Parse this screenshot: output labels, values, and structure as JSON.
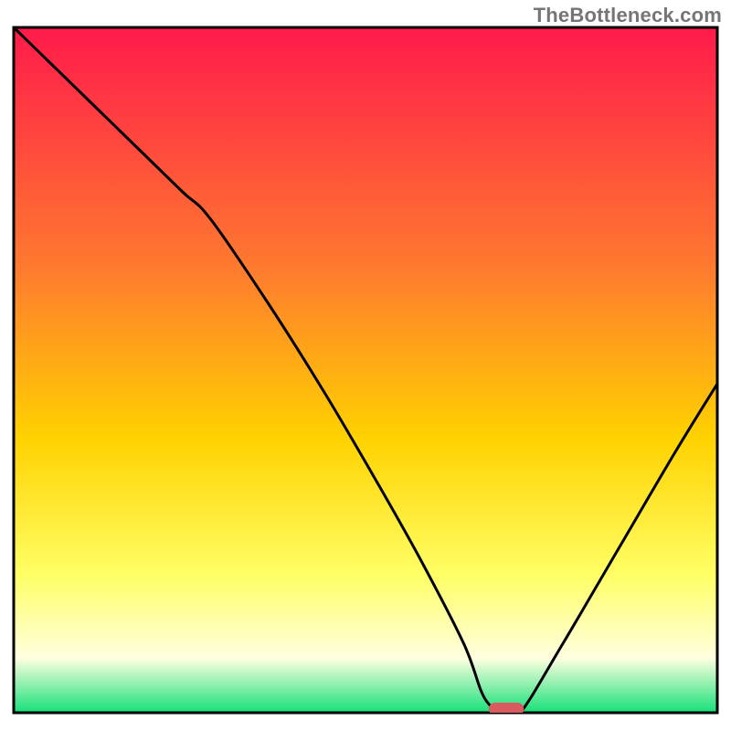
{
  "watermark": "TheBottleneck.com",
  "colors": {
    "gradient_top": "#ff1a4b",
    "gradient_mid1": "#ff7a2f",
    "gradient_mid2": "#ffd200",
    "gradient_mid3": "#ffff66",
    "gradient_mid4": "#ffffe0",
    "gradient_bottom": "#17e079",
    "curve": "#000000",
    "marker_fill": "#d95a5f",
    "frame": "#000000"
  },
  "chart_data": {
    "type": "line",
    "title": "",
    "xlabel": "",
    "ylabel": "",
    "xlim": [
      0,
      100
    ],
    "ylim": [
      0,
      100
    ],
    "notes": "Y is a mismatch/bottleneck percentage (0 at bottom, 100 at top). X is an unlabeled configuration axis. Curve drops from ~100 at the left edge to ~0 near x≈68–72 (the optimal point, marked by a red pill on the x-axis), then rises again toward the right edge.",
    "series": [
      {
        "name": "curve",
        "x": [
          0,
          6,
          12,
          18,
          24,
          28,
          36,
          44,
          52,
          58,
          64,
          67,
          70,
          72,
          78,
          86,
          94,
          100
        ],
        "values": [
          100,
          94,
          88,
          82,
          76,
          72,
          60,
          47,
          33,
          22,
          10,
          2,
          0,
          0,
          10,
          24,
          38,
          48
        ]
      }
    ],
    "flat_segment": {
      "x_start": 67,
      "x_end": 72,
      "y": 0
    },
    "marker": {
      "x_center": 70,
      "x_halfwidth": 2.5,
      "y": 0
    }
  }
}
